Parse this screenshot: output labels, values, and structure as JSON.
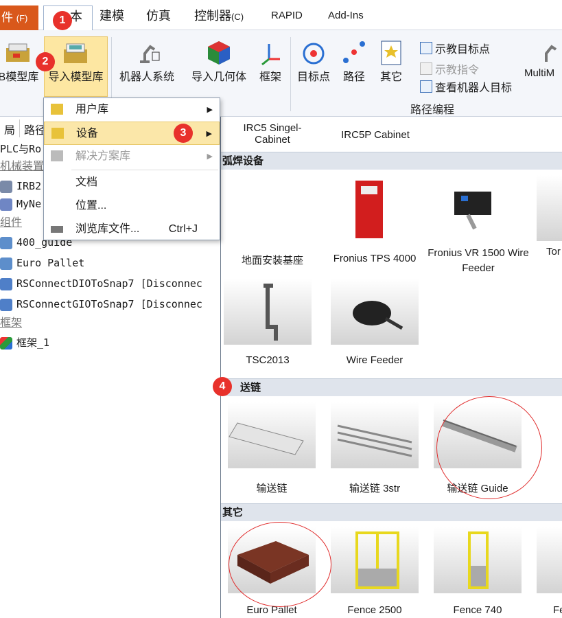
{
  "menubar": {
    "file": "件",
    "file_key": "(F)",
    "home": "本",
    "tabs": [
      {
        "label": "建模"
      },
      {
        "label": "仿真"
      },
      {
        "label": "控制器",
        "key": "(C)"
      },
      {
        "label": "RAPID"
      },
      {
        "label": "Add-Ins"
      }
    ]
  },
  "ribbon": {
    "buttons": [
      {
        "label": "B模型库"
      },
      {
        "label": "导入模型库"
      },
      {
        "label": "机器人系统"
      },
      {
        "label": "导入几何体"
      },
      {
        "label": "框架"
      },
      {
        "label": "目标点"
      },
      {
        "label": "路径"
      },
      {
        "label": "其它"
      },
      {
        "label": "MultiM"
      }
    ],
    "small": [
      {
        "label": "示教目标点",
        "enabled": true
      },
      {
        "label": "示教指令",
        "enabled": false
      },
      {
        "label": "查看机器人目标",
        "enabled": true
      }
    ],
    "group_path": "路径编程"
  },
  "leftpane": {
    "tabs": [
      "局",
      "路径"
    ],
    "tree": [
      {
        "text": "PLC与Ro",
        "kind": "plain"
      },
      {
        "text": "机械装置",
        "kind": "cat"
      },
      {
        "text": "IRB2",
        "kind": "robot"
      },
      {
        "text": "MyNe",
        "kind": "robot"
      },
      {
        "text": "组件",
        "kind": "cat"
      },
      {
        "text": "400_guide",
        "kind": "part"
      },
      {
        "text": "Euro Pallet",
        "kind": "part"
      },
      {
        "text": "RSConnectDIOToSnap7 [Disconnec",
        "kind": "smart"
      },
      {
        "text": "RSConnectGIOToSnap7 [Disconnec",
        "kind": "smart"
      },
      {
        "text": "框架",
        "kind": "cat"
      },
      {
        "text": "框架_1",
        "kind": "frame"
      }
    ]
  },
  "dropdown": {
    "items": [
      {
        "label": "用户库",
        "arrow": true,
        "disabled": false,
        "highlight": false
      },
      {
        "label": "设备",
        "arrow": true,
        "disabled": false,
        "highlight": true
      },
      {
        "label": "解决方案库",
        "arrow": true,
        "disabled": true,
        "highlight": false
      },
      {
        "label": "文档",
        "arrow": false,
        "disabled": false,
        "highlight": false
      },
      {
        "label": "位置...",
        "arrow": false,
        "disabled": false,
        "highlight": false
      },
      {
        "label": "浏览库文件...",
        "shortcut": "Ctrl+J",
        "arrow": false,
        "disabled": false,
        "highlight": false
      }
    ]
  },
  "library": {
    "top_items": [
      "IRC5 Singel-Cabinet",
      "IRC5P Cabinet"
    ],
    "sections": [
      {
        "title": "弧焊设备",
        "items": [
          "地面安装基座",
          "Fronius TPS 4000",
          "Fronius VR 1500 Wire Feeder",
          "Tor",
          "TSC2013",
          "Wire Feeder"
        ]
      },
      {
        "title": "送链",
        "items": [
          "输送链",
          "输送链 3str",
          "输送链 Guide"
        ]
      },
      {
        "title": "其它",
        "items": [
          "Euro Pallet",
          "Fence 2500",
          "Fence 740",
          "Fe"
        ]
      }
    ]
  },
  "badges": [
    "1",
    "2",
    "3",
    "4"
  ],
  "colors": {
    "file_tab": "#d9581b",
    "badge": "#e8312b",
    "highlight": "#fbe7a9",
    "section": "#dfe4ec"
  }
}
